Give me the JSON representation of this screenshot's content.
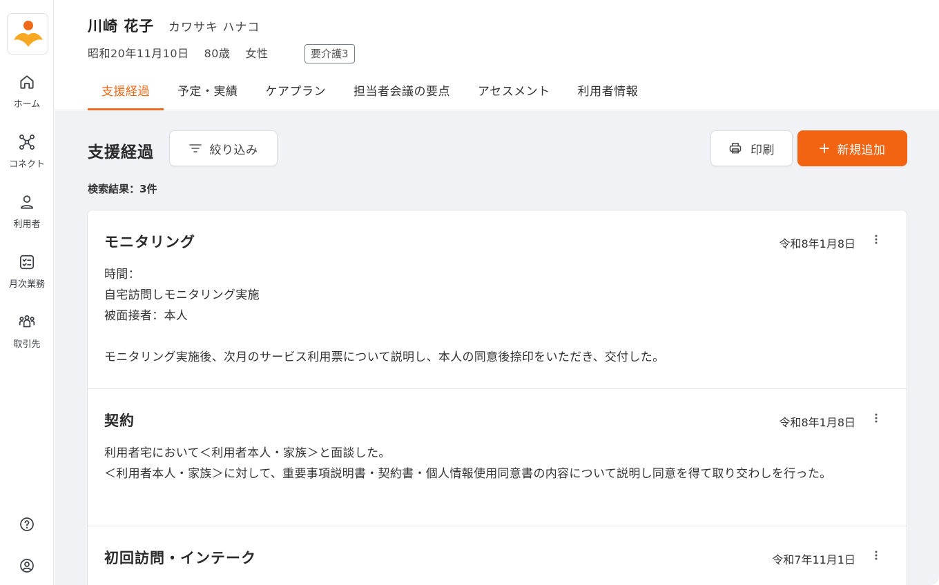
{
  "sidebar": {
    "items": [
      {
        "label": "ホーム",
        "icon": "home-icon"
      },
      {
        "label": "コネクト",
        "icon": "connect-icon"
      },
      {
        "label": "利用者",
        "icon": "user-icon"
      },
      {
        "label": "月次業務",
        "icon": "checklist-icon"
      },
      {
        "label": "取引先",
        "icon": "group-icon"
      }
    ],
    "bottom_icons": [
      "help-icon",
      "account-icon"
    ]
  },
  "header": {
    "name": "川崎 花子",
    "kana": "カワサキ ハナコ",
    "birthdate": "昭和20年11月10日",
    "age": "80歳",
    "gender": "女性",
    "care_level": "要介護3"
  },
  "tabs": [
    {
      "label": "支援経過",
      "active": true
    },
    {
      "label": "予定・実績",
      "active": false
    },
    {
      "label": "ケアプラン",
      "active": false
    },
    {
      "label": "担当者会議の要点",
      "active": false
    },
    {
      "label": "アセスメント",
      "active": false
    },
    {
      "label": "利用者情報",
      "active": false
    }
  ],
  "main": {
    "title": "支援経過",
    "filter_label": "絞り込み",
    "print_label": "印刷",
    "add_label": "新規追加",
    "result_count": "検索結果：3件",
    "records": [
      {
        "title": "モニタリング",
        "date": "令和8年1月8日",
        "body": "時間：\n自宅訪問しモニタリング実施\n被面接者：本人\n\nモニタリング実施後、次月のサービス利用票について説明し、本人の同意後捺印をいただき、交付した。"
      },
      {
        "title": "契約",
        "date": "令和8年1月8日",
        "body": "利用者宅において＜利用者本人・家族＞と面談した。\n＜利用者本人・家族＞に対して、重要事項説明書・契約書・個人情報使用同意書の内容について説明し同意を得て取り交わしを行った。"
      },
      {
        "title": "初回訪問・インテーク",
        "date": "令和7年11月1日",
        "body": ""
      }
    ]
  },
  "colors": {
    "accent": "#ee6a1a",
    "add_button": "#f26312",
    "main_bg": "#f1f2f6"
  }
}
